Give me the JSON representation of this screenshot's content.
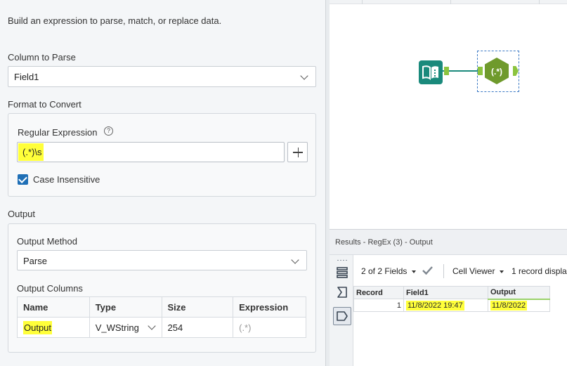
{
  "config": {
    "description": "Build an expression to parse, match, or replace data.",
    "column_to_parse": {
      "label": "Column to Parse",
      "value": "Field1"
    },
    "format_to_convert": {
      "label": "Format to Convert",
      "regex_label": "Regular Expression",
      "help_glyph": "?",
      "regex_value": "(.*)\\s",
      "case_insensitive_label": "Case Insensitive",
      "case_insensitive_checked": true
    },
    "output": {
      "label": "Output",
      "method_label": "Output Method",
      "method_value": "Parse",
      "columns_label": "Output Columns",
      "columns_headers": [
        "Name",
        "Type",
        "Size",
        "Expression"
      ],
      "columns_row": {
        "name": "Output",
        "type": "V_WString",
        "size": "254",
        "expression": "(.*)"
      }
    }
  },
  "canvas": {
    "regex_tool_glyph": "(.*)",
    "input_tool_icon": "book-icon"
  },
  "results": {
    "title": "Results - RegEx (3) - Output",
    "fields_label": "2 of 2 Fields",
    "cell_viewer_label": "Cell Viewer",
    "records_label": "1 record displa",
    "headers": [
      "Record",
      "Field1",
      "Output"
    ],
    "rows": [
      {
        "record": "1",
        "field1": "11/8/2022 19:47",
        "output": "11/8/2022"
      }
    ]
  },
  "colors": {
    "highlight": "#ffff3a",
    "tool_teal": "#1a8a7c",
    "regex_green": "#6f9a2c",
    "anchor_green": "#8cc43f",
    "checkbox_blue": "#1f6fb6"
  }
}
